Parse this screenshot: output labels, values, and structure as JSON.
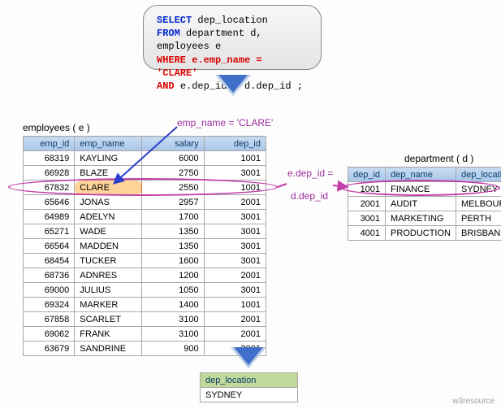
{
  "sql": {
    "select": "SELECT",
    "select_col": "dep_location",
    "from": "FROM",
    "from_rest": "department d, employees e",
    "where": "WHERE",
    "where_rest": "e.emp_name = 'CLARE'",
    "and": "AND",
    "and_rest": "e.dep_id = d.dep_id ;"
  },
  "titles": {
    "employees": "employees ( e )",
    "department": "department ( d )"
  },
  "annot": {
    "emp_name": "emp_name = 'CLARE'",
    "edep": "e.dep_id =",
    "ddep": "d.dep_id"
  },
  "emp": {
    "headers": [
      "emp_id",
      "emp_name",
      "salary",
      "dep_id"
    ],
    "rows": [
      [
        "68319",
        "KAYLING",
        "6000",
        "1001"
      ],
      [
        "66928",
        "BLAZE",
        "2750",
        "3001"
      ],
      [
        "67832",
        "CLARE",
        "2550",
        "1001"
      ],
      [
        "65646",
        "JONAS",
        "2957",
        "2001"
      ],
      [
        "64989",
        "ADELYN",
        "1700",
        "3001"
      ],
      [
        "65271",
        "WADE",
        "1350",
        "3001"
      ],
      [
        "66564",
        "MADDEN",
        "1350",
        "3001"
      ],
      [
        "68454",
        "TUCKER",
        "1600",
        "3001"
      ],
      [
        "68736",
        "ADNRES",
        "1200",
        "2001"
      ],
      [
        "69000",
        "JULIUS",
        "1050",
        "3001"
      ],
      [
        "69324",
        "MARKER",
        "1400",
        "1001"
      ],
      [
        "67858",
        "SCARLET",
        "3100",
        "2001"
      ],
      [
        "69062",
        "FRANK",
        "3100",
        "2001"
      ],
      [
        "63679",
        "SANDRINE",
        "900",
        "2001"
      ]
    ]
  },
  "dep": {
    "headers": [
      "dep_id",
      "dep_name",
      "dep_location"
    ],
    "rows": [
      [
        "1001",
        "FINANCE",
        "SYDNEY"
      ],
      [
        "2001",
        "AUDIT",
        "MELBOURNE"
      ],
      [
        "3001",
        "MARKETING",
        "PERTH"
      ],
      [
        "4001",
        "PRODUCTION",
        "BRISBANE"
      ]
    ]
  },
  "result": {
    "header": "dep_location",
    "value": "SYDNEY"
  },
  "footer": "w3resource"
}
